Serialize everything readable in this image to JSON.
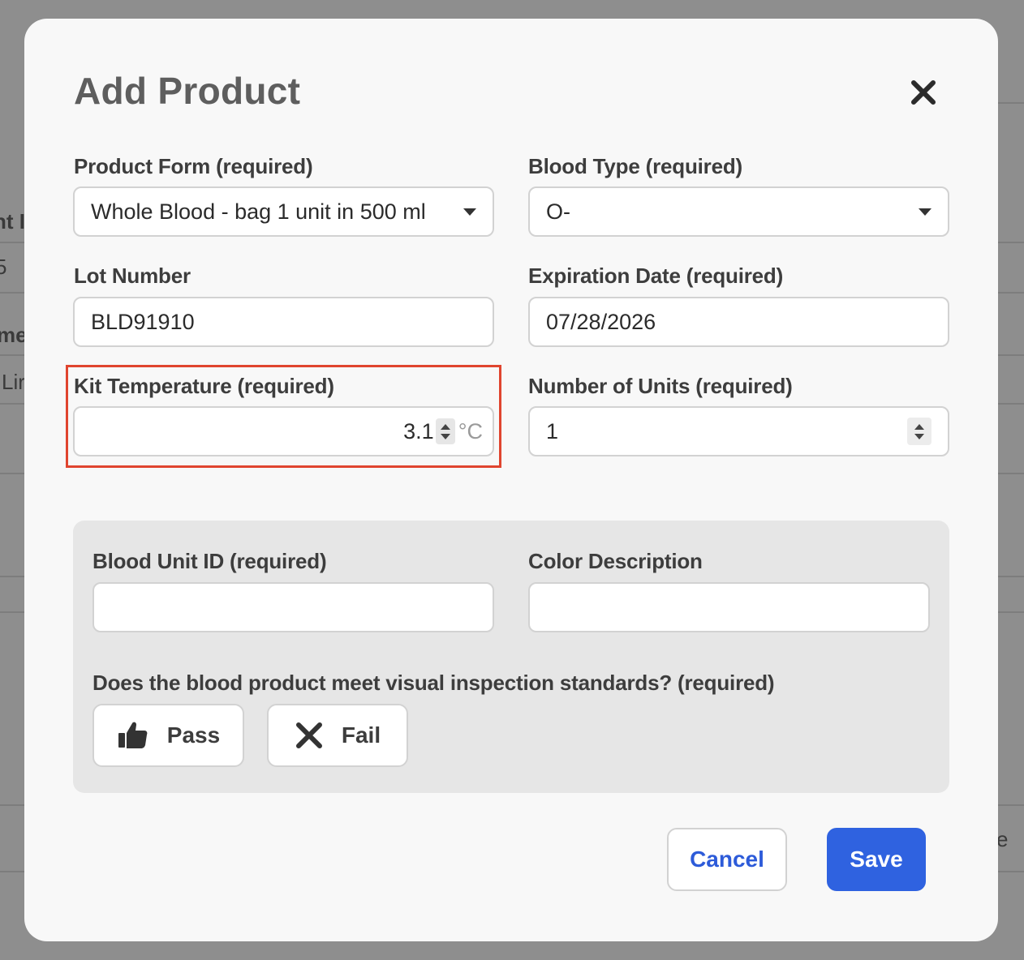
{
  "background": {
    "fragments": [
      "nt I",
      "5",
      "me",
      "Lir",
      "e"
    ]
  },
  "modal": {
    "title": "Add Product",
    "close_icon": "close-icon"
  },
  "form": {
    "product_form": {
      "label": "Product Form (required)",
      "value": "Whole Blood - bag 1 unit in 500 ml"
    },
    "blood_type": {
      "label": "Blood Type (required)",
      "value": "O-"
    },
    "lot_number": {
      "label": "Lot Number",
      "value": "BLD91910"
    },
    "expiration_date": {
      "label": "Expiration Date (required)",
      "value": "07/28/2026"
    },
    "kit_temperature": {
      "label": "Kit Temperature (required)",
      "value": "3.1",
      "unit": "°C"
    },
    "number_of_units": {
      "label": "Number of Units (required)",
      "value": "1"
    }
  },
  "unit_panel": {
    "blood_unit_id": {
      "label": "Blood Unit ID (required)",
      "value": ""
    },
    "color_description": {
      "label": "Color Description",
      "value": ""
    },
    "inspection_question": "Does the blood product meet visual inspection standards? (required)",
    "pass_label": "Pass",
    "fail_label": "Fail",
    "pass_icon": "thumbs-up-icon",
    "fail_icon": "x-icon"
  },
  "footer": {
    "cancel_label": "Cancel",
    "save_label": "Save"
  },
  "colors": {
    "accent": "#2f62e0",
    "highlight": "#e0452f"
  }
}
